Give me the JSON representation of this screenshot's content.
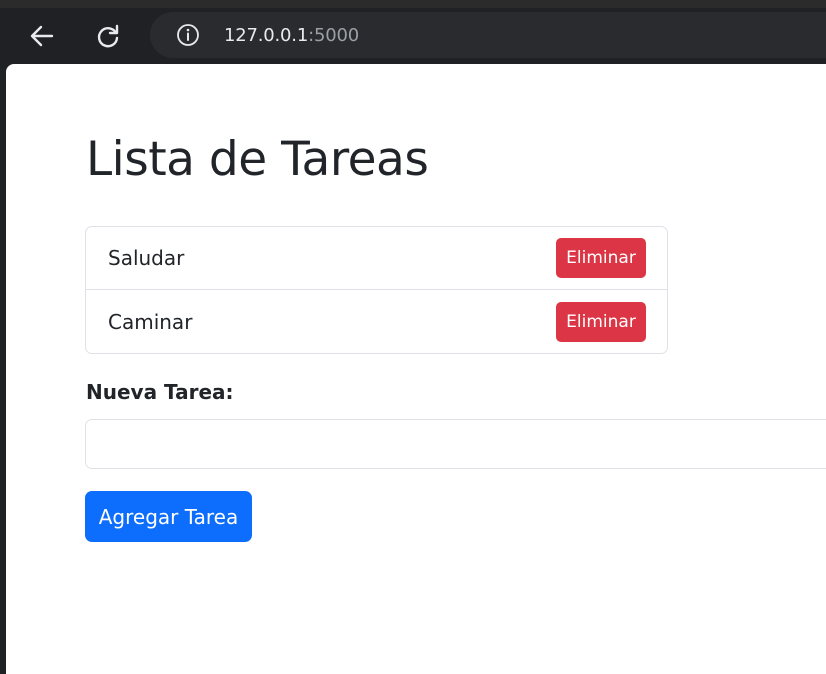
{
  "browser": {
    "url_host": "127.0.0.1",
    "url_port": ":5000",
    "icons": {
      "back": "arrow-left-icon",
      "reload": "reload-icon",
      "info": "info-icon"
    }
  },
  "page": {
    "title": "Lista de Tareas",
    "tasks": [
      {
        "text": "Saludar",
        "delete_label": "Eliminar"
      },
      {
        "text": "Caminar",
        "delete_label": "Eliminar"
      }
    ],
    "form": {
      "label": "Nueva Tarea:",
      "input_value": "",
      "submit_label": "Agregar Tarea"
    }
  },
  "colors": {
    "danger": "#dc3545",
    "primary": "#0d6efd",
    "text": "#212529",
    "border": "#dee2e6"
  }
}
